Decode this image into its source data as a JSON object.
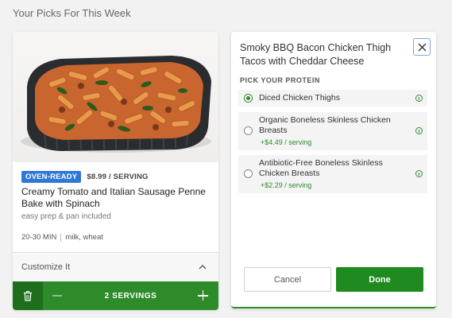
{
  "page": {
    "heading": "Your Picks For This Week"
  },
  "meal": {
    "badge": "OVEN-READY",
    "price": "$8.99 / SERVING",
    "title": "Creamy Tomato and Italian Sausage Penne Bake with Spinach",
    "subtitle": "easy prep & pan included",
    "time": "20-30 MIN",
    "allergens": "milk, wheat",
    "customize_label": "Customize It",
    "servings_label": "2 SERVINGS"
  },
  "protein_panel": {
    "title": "Smoky BBQ Bacon Chicken Thigh Tacos with Cheddar Cheese",
    "section_label": "PICK YOUR PROTEIN",
    "options": [
      {
        "label": "Diced Chicken Thighs",
        "price": "",
        "selected": true
      },
      {
        "label": "Organic Boneless Skinless Chicken Breasts",
        "price": "+$4.49 / serving",
        "selected": false
      },
      {
        "label": "Antibiotic-Free Boneless Skinless Chicken Breasts",
        "price": "+$2.29 / serving",
        "selected": false
      }
    ],
    "cancel_label": "Cancel",
    "done_label": "Done"
  },
  "colors": {
    "accent_green": "#2e8b2a",
    "badge_blue": "#2f78d6"
  },
  "icons": [
    "trash-icon",
    "minus-icon",
    "plus-icon",
    "chevron-up-icon",
    "close-icon",
    "info-icon"
  ]
}
